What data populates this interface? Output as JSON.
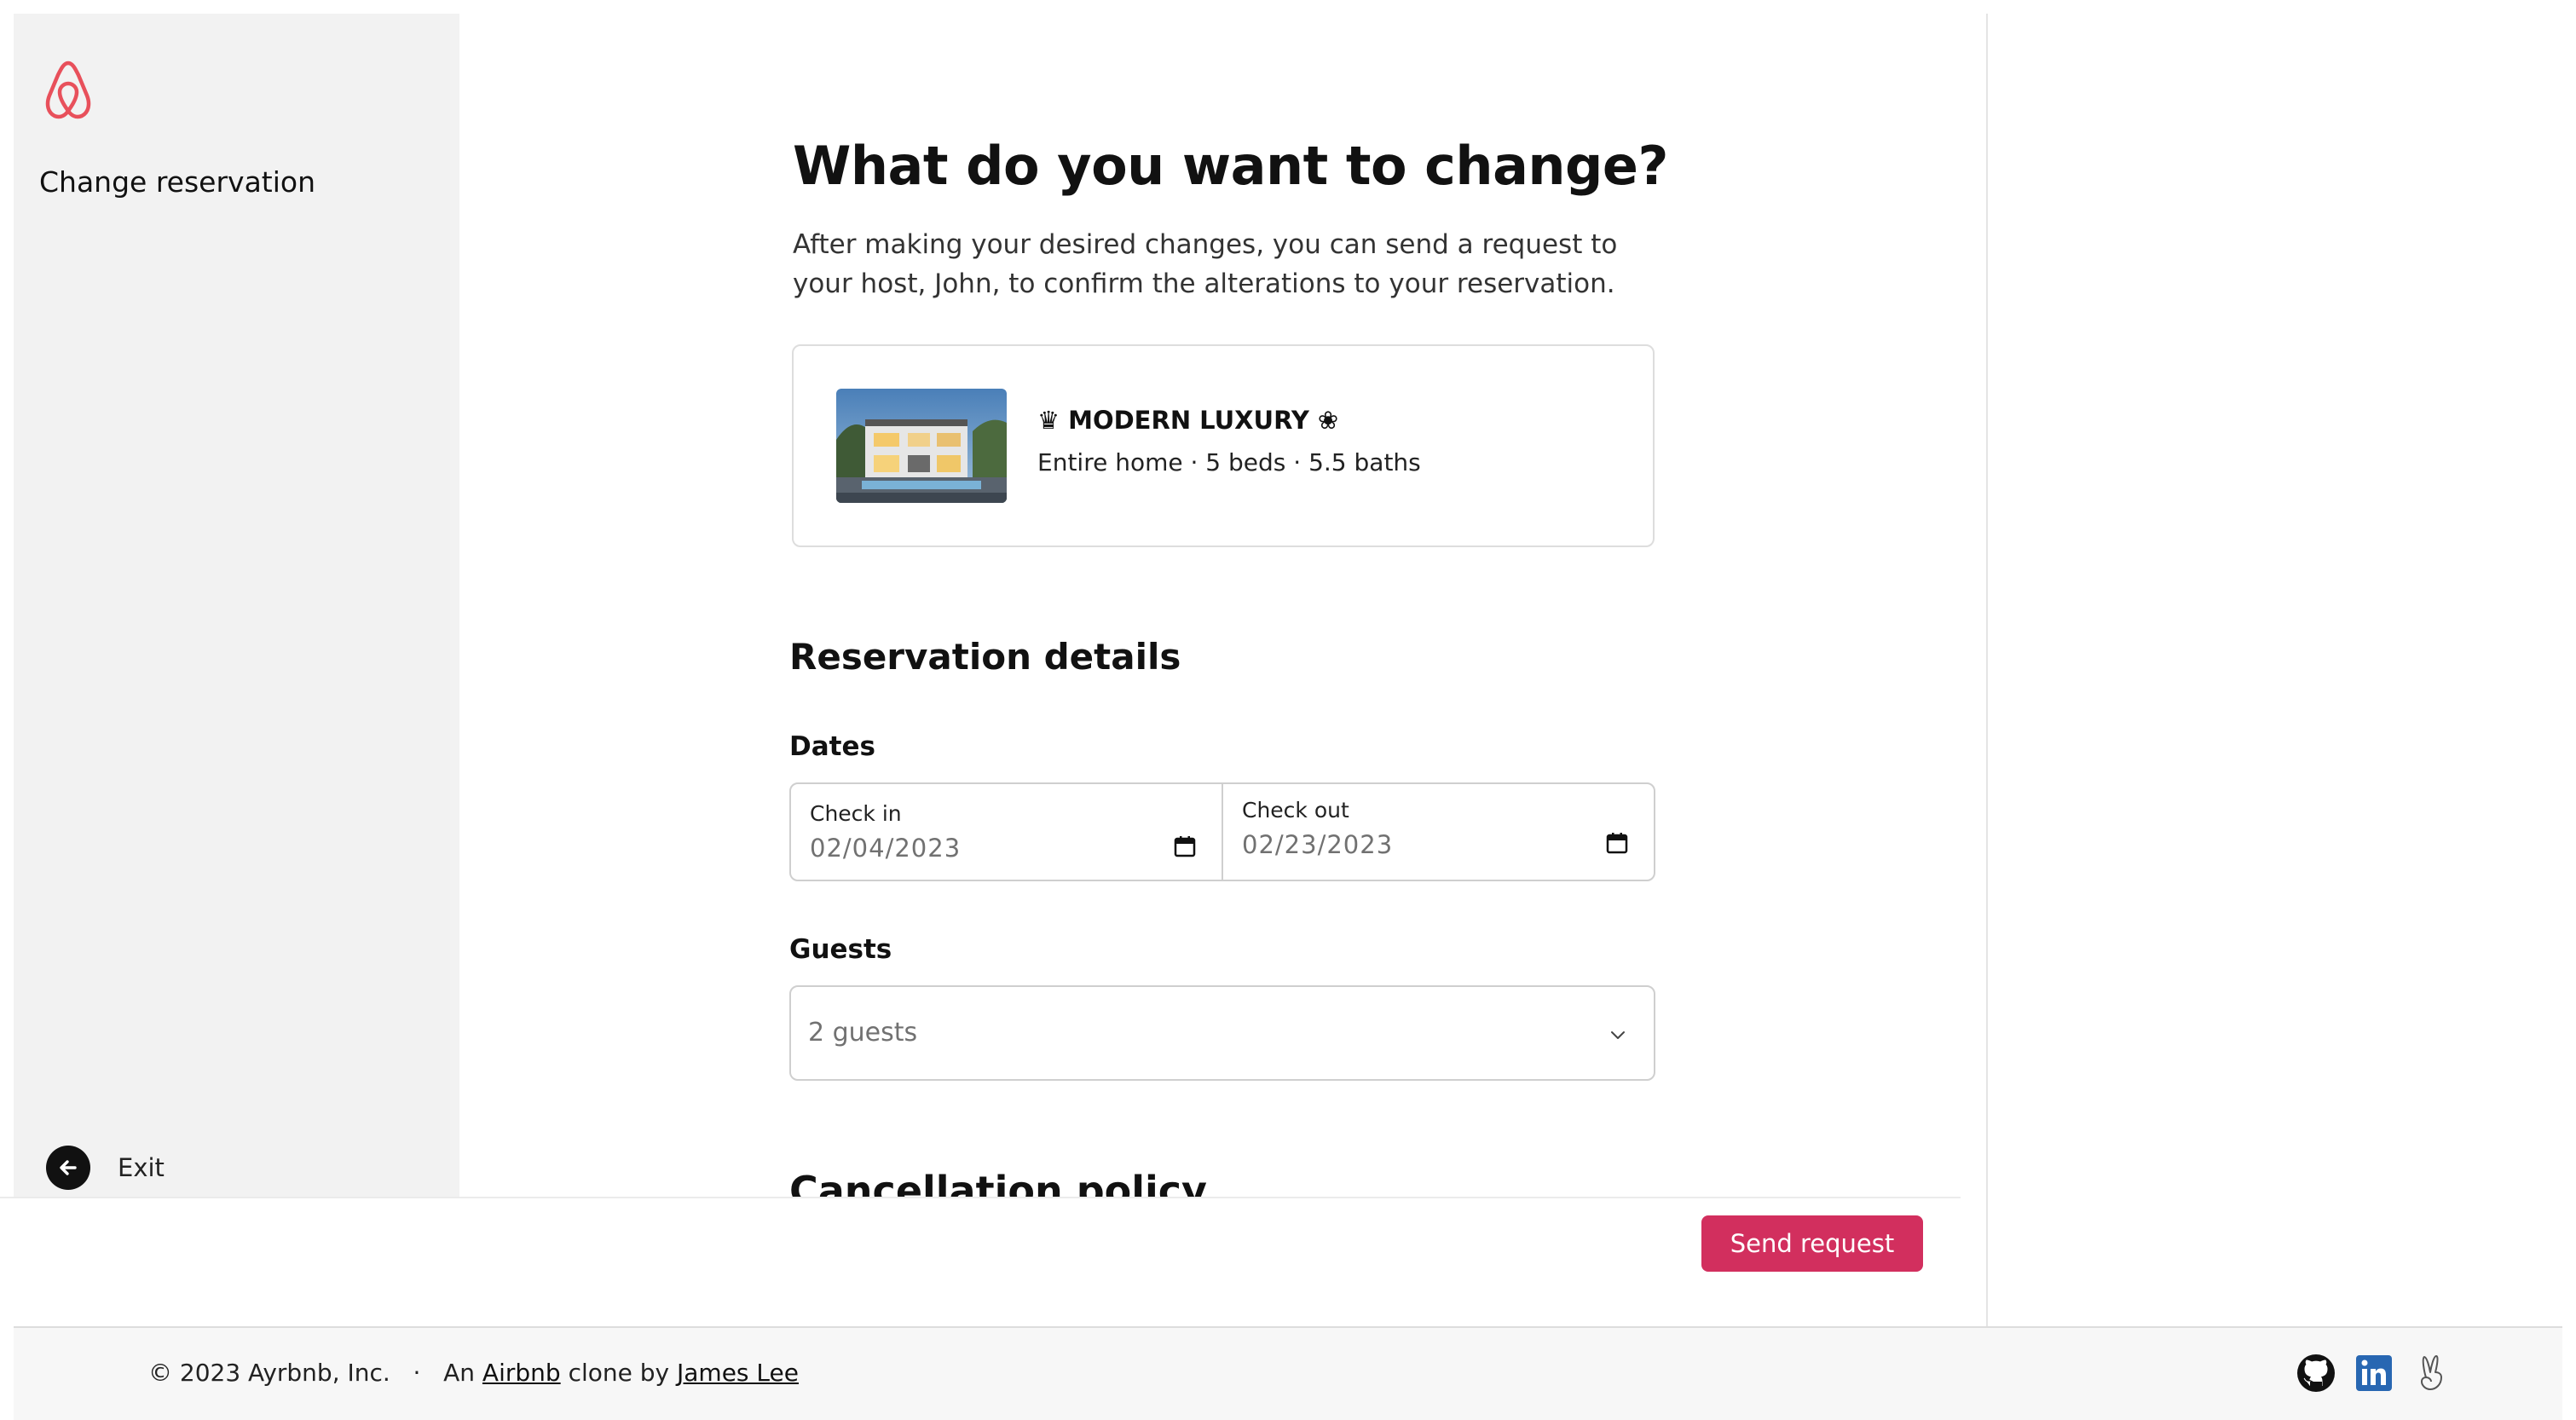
{
  "sidebar": {
    "title": "Change reservation",
    "exit_label": "Exit"
  },
  "main": {
    "heading": "What do you want to change?",
    "intro": "After making your desired changes, you can send a request to your host, John, to confirm the alterations to your reservation."
  },
  "listing": {
    "name": "♛ MODERN LUXURY ❀",
    "meta": "Entire home · 5 beds · 5.5 baths"
  },
  "reservation": {
    "section_title": "Reservation details",
    "dates_label": "Dates",
    "check_in_label": "Check in",
    "check_in_value": "02/04/2023",
    "check_out_label": "Check out",
    "check_out_value": "02/23/2023",
    "guests_label": "Guests",
    "guests_value": "2 guests"
  },
  "cancellation": {
    "title": "Cancellation policy"
  },
  "actions": {
    "send_label": "Send request"
  },
  "footer": {
    "copyright": "© 2023 Ayrbnb, Inc.",
    "separator": "·",
    "prefix": "An",
    "airbnb_link": "Airbnb",
    "middle": "clone by",
    "author_link": "James Lee"
  },
  "theme": {
    "brand": "#d22f5e",
    "logo": "#e8505b"
  },
  "icons": [
    "airbnb-logo-icon",
    "exit-arrow-icon",
    "calendar-icon",
    "chevron-down-icon",
    "github-icon",
    "linkedin-icon",
    "angellist-icon"
  ]
}
